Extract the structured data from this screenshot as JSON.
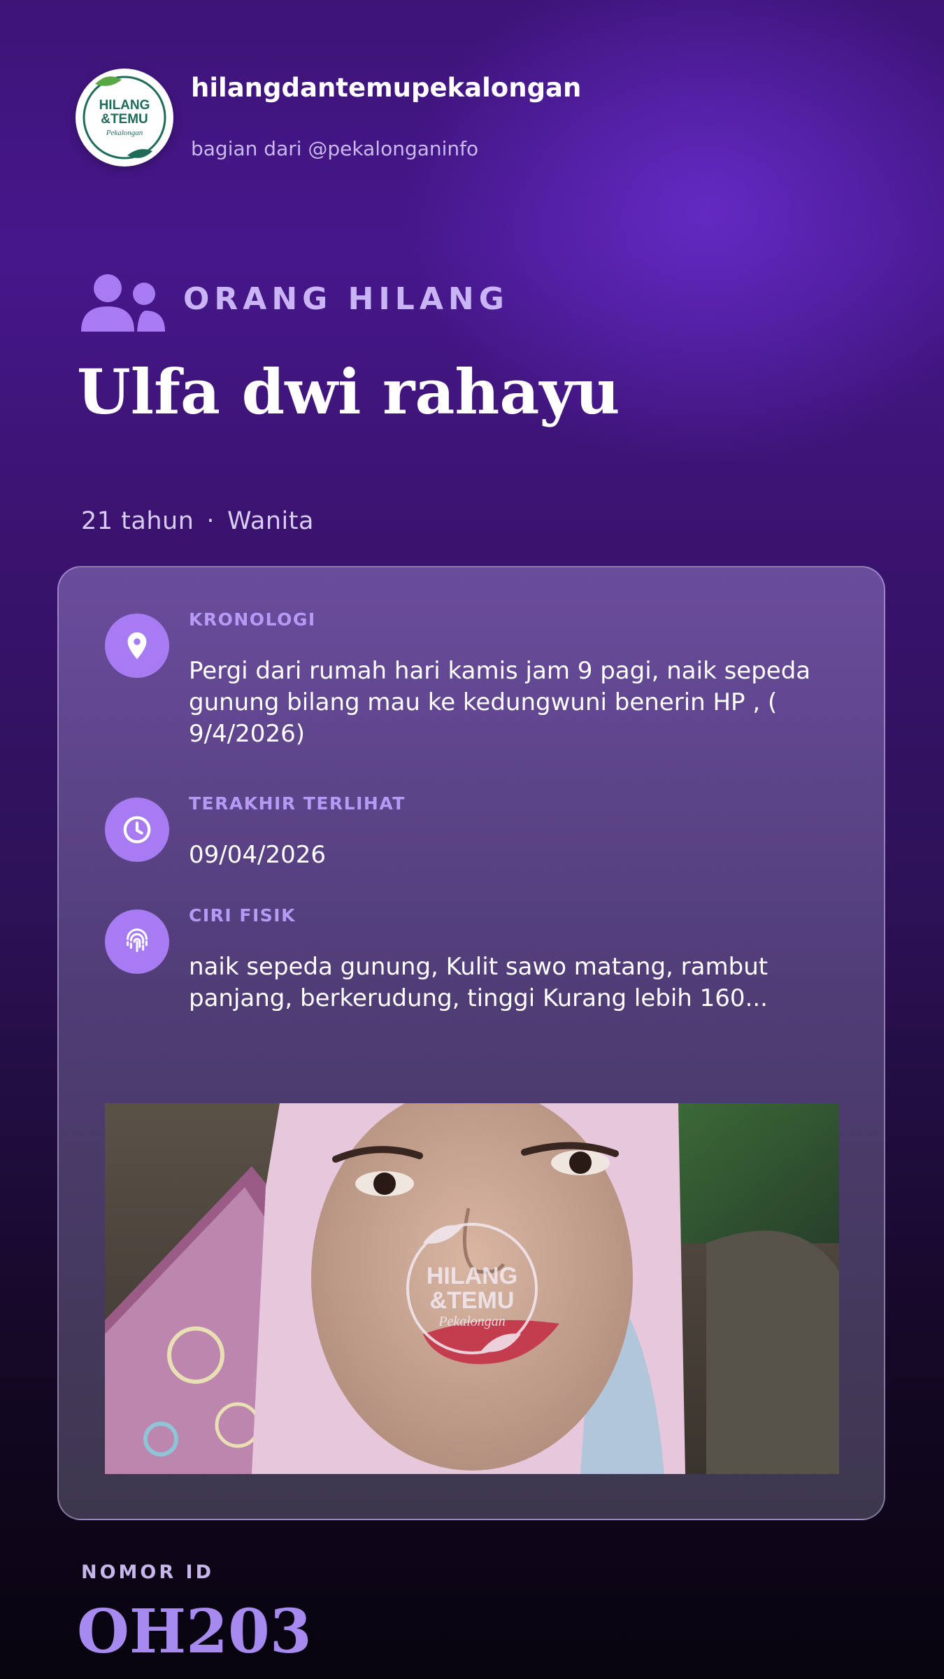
{
  "header": {
    "account_name": "hilangdantemupekalongan",
    "subtitle": "bagian dari @pekalonganinfo",
    "logo": {
      "line1": "HILANG",
      "line2": "&TEMU",
      "line3": "Pekalongan"
    }
  },
  "category": {
    "icon": "people-icon",
    "label": "ORANG HILANG"
  },
  "person": {
    "name": "Ulfa dwi rahayu",
    "age": "21 tahun",
    "separator": "·",
    "gender": "Wanita"
  },
  "details": [
    {
      "icon": "location-pin-icon",
      "title": "KRONOLOGI",
      "text": "Pergi dari rumah hari kamis jam 9 pagi, naik sepeda gunung bilang mau ke kedungwuni benerin HP , ( 9/4/2026)"
    },
    {
      "icon": "clock-icon",
      "title": "TERAKHIR TERLIHAT",
      "text": "09/04/2026"
    },
    {
      "icon": "fingerprint-icon",
      "title": "CIRI FISIK",
      "text": "naik sepeda gunung, Kulit sawo matang, rambut panjang, berkerudung, tinggi Kurang lebih 160..."
    }
  ],
  "photo": {
    "watermark": {
      "line1": "HILANG",
      "line2": "&TEMU",
      "line3": "Pekalongan"
    }
  },
  "id": {
    "label": "NOMOR ID",
    "value": "OH203"
  },
  "colors": {
    "accent": "#a77cf2",
    "accent_light": "#b79af6",
    "id_value": "#a78af0",
    "logo_green": "#1f6b5a"
  }
}
